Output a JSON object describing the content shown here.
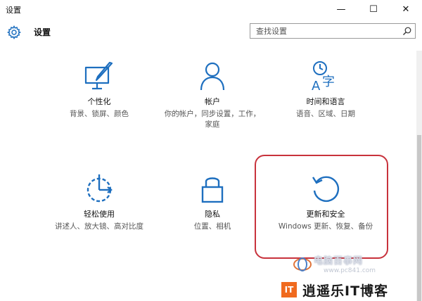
{
  "window": {
    "title": "设置",
    "minimize_glyph": "—",
    "maximize_glyph": "☐",
    "close_glyph": "✕"
  },
  "header": {
    "heading": "设置",
    "search_placeholder": "查找设置"
  },
  "tiles": [
    {
      "name": "个性化",
      "desc": "背景、锁屏、颜色",
      "icon": "personalization-icon"
    },
    {
      "name": "帐户",
      "desc": "你的帐户，同步设置，工作，家庭",
      "icon": "account-icon"
    },
    {
      "name": "时间和语言",
      "desc": "语音、区域、日期",
      "icon": "time-language-icon"
    },
    {
      "name": "轻松使用",
      "desc": "讲述人、放大镜、高对比度",
      "icon": "ease-of-access-icon"
    },
    {
      "name": "隐私",
      "desc": "位置、相机",
      "icon": "privacy-lock-icon"
    },
    {
      "name": "更新和安全",
      "desc": "Windows 更新、恢复、备份",
      "icon": "update-icon"
    }
  ],
  "colors": {
    "accent": "#1e6fbf",
    "highlight": "#c8323c"
  },
  "watermark": {
    "site_name": "电脑百事网",
    "site_url": "www.pc841.com",
    "blog_mark": "IT",
    "blog_name": "逍遥乐IT博客"
  }
}
